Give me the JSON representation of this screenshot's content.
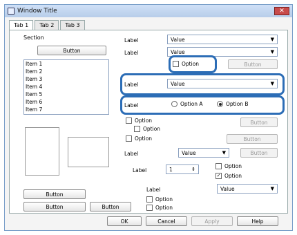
{
  "window": {
    "title": "Window Title",
    "close_glyph": "✕"
  },
  "tabs": [
    {
      "label": "Tab 1"
    },
    {
      "label": "Tab 2"
    },
    {
      "label": "Tab 3"
    }
  ],
  "left": {
    "section_title": "Section",
    "register_button": "Button",
    "presets": [
      {
        "label": "Item 1"
      },
      {
        "label": "Item 2"
      },
      {
        "label": "Item 3"
      },
      {
        "label": "Item 4"
      },
      {
        "label": "Item 5"
      },
      {
        "label": "Item 6"
      },
      {
        "label": "Item 7"
      }
    ],
    "preview_caption": "",
    "show_settings_button": "Button",
    "reset_button": "Button",
    "ink_button": "Button"
  },
  "right": {
    "source_label": "Label",
    "source_value": "Value",
    "paper_size_label": "Label",
    "paper_size_value": "Value",
    "borderless_label": "Option",
    "borderless_checked": false,
    "extend_button": "Button",
    "paper_type_label": "Label",
    "paper_type_value": "Value",
    "color_label": "Label",
    "color_opt1": "Option A",
    "color_opt2": "Option B",
    "color_selected": "opt2",
    "duplex_label": "Option",
    "duplex_checked": false,
    "auto_label": "Option",
    "auto_checked": false,
    "settings_button": "Button",
    "facedown_label": "Option",
    "facedown_checked": false,
    "density_button": "Button",
    "layout_label": "Label",
    "layout_value": "Value",
    "layout_settings_button": "Button",
    "copies_label": "Label",
    "copies_value": "1",
    "collate_label": "Option",
    "collate_checked": false,
    "reverse_label": "Option",
    "reverse_checked": true,
    "quiet_label": "Label",
    "quiet_value": "Value",
    "preview_label": "Option",
    "preview_checked": false,
    "lite_label": "Option",
    "lite_checked": false
  },
  "bottom": {
    "ok": "OK",
    "cancel": "Cancel",
    "apply": "Apply",
    "help": "Help"
  }
}
